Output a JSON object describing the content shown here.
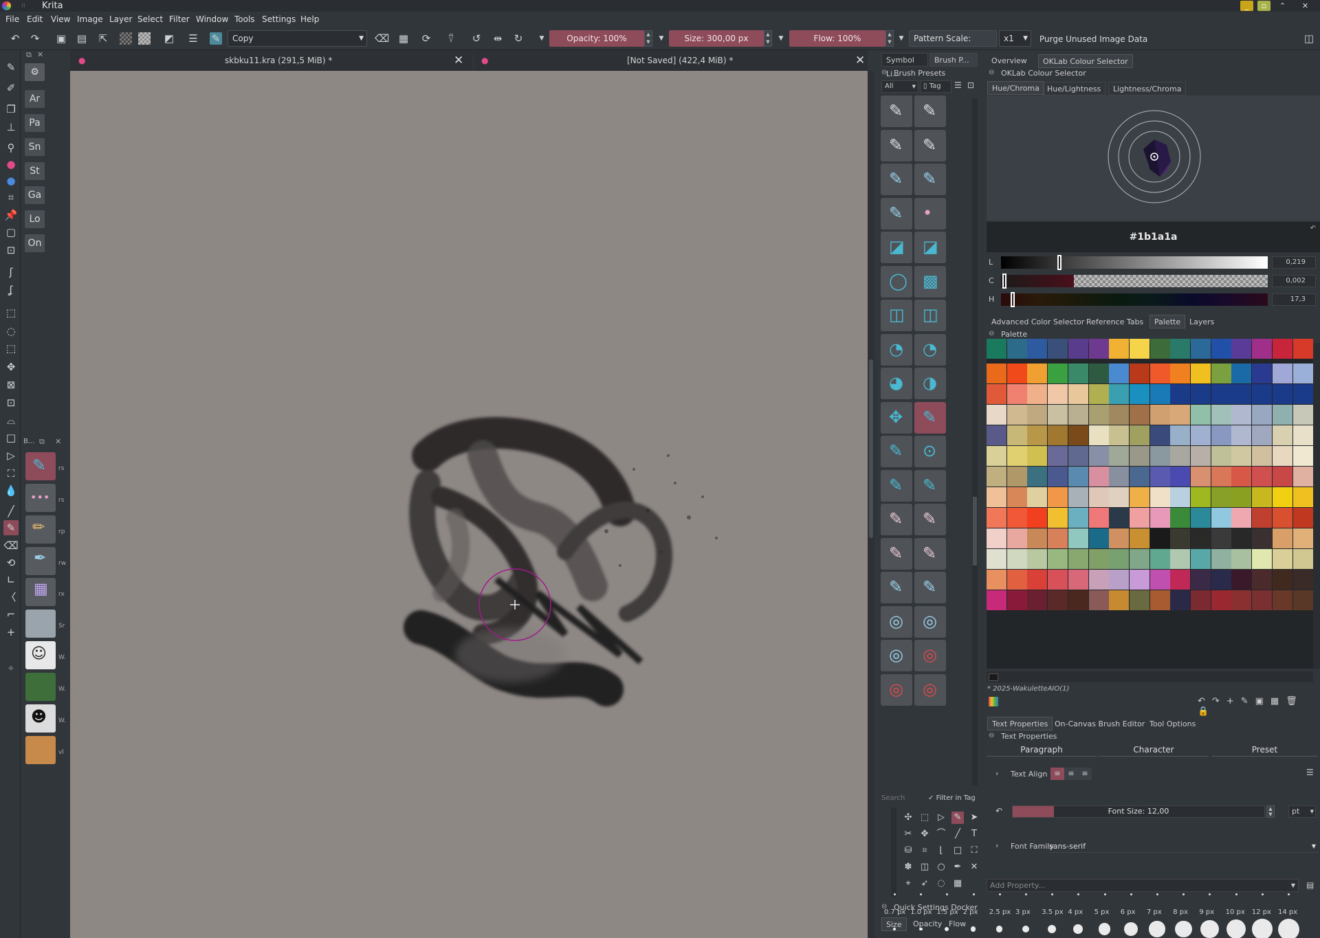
{
  "app": {
    "title": "Krita"
  },
  "menu": [
    "File",
    "Edit",
    "View",
    "Image",
    "Layer",
    "Select",
    "Filter",
    "Window",
    "Tools",
    "Settings",
    "Help"
  ],
  "toolbar": {
    "blend_mode": "Copy",
    "opacity": "Opacity: 100%",
    "size": "Size: 300,00 px",
    "flow": "Flow: 100%",
    "pattern_scale": "Pattern Scale: 1,00x",
    "mirror": "x1",
    "purge": "Purge Unused Image Data"
  },
  "shortcuts": [
    "Ar",
    "Pa",
    "Sn",
    "St",
    "Ga",
    "Lo",
    "On"
  ],
  "brush_mini_labels": [
    "rs",
    "rs",
    "rp",
    "rw",
    "rx",
    "Sr",
    "W.",
    "W.",
    "W.",
    "vl"
  ],
  "brush_mini_header": "B...",
  "documents": [
    {
      "title": "skbku11.kra (291,5 MiB) *"
    },
    {
      "title": "[Not Saved]  (422,4 MiB) *"
    }
  ],
  "brush_presets": {
    "tabs": [
      "Symbol Li...",
      "Brush P..."
    ],
    "header": "Brush Presets",
    "filter": "All",
    "tag": "Tag",
    "search_placeholder": "Search",
    "filter_in_tag": "Filter in Tag"
  },
  "color_selector": {
    "tabs": [
      "Overview",
      "OKLab Colour Selector"
    ],
    "header": "OKLab Colour Selector",
    "mode_tabs": [
      "Hue/Chroma",
      "Hue/Lightness",
      "Lightness/Chroma"
    ],
    "hex": "#1b1a1a",
    "channels": [
      {
        "name": "L",
        "value": "0,219"
      },
      {
        "name": "C",
        "value": "0,002"
      },
      {
        "name": "H",
        "value": "17,3"
      }
    ]
  },
  "dock_tabs": [
    "Advanced Color Selector",
    "Reference Tabs",
    "Palette",
    "Layers"
  ],
  "palette": {
    "header": "Palette",
    "name": "* 2025-WakuletteAIO(1)",
    "colors": [
      [
        "#1a7a5e",
        "#2d6b8a",
        "#2e5aa0",
        "#3a4f7a",
        "#5a3c8c",
        "#6e3a90",
        "#f1b233",
        "#f5d44a",
        "#3d6b3a",
        "#2a7a6a",
        "#2b6a98",
        "#2050a8",
        "#5a3c98",
        "#a02f8a",
        "#c8243a",
        "#d83a2a"
      ],
      [
        "#e86a1a",
        "#f04a1a",
        "#f0a030",
        "#3aa040",
        "#3a8a6a",
        "#2d5a40",
        "#4a8ad0",
        "#b83a1a",
        "#f05a2a",
        "#f08020",
        "#f0c020",
        "#7aa040",
        "#1a6aa8",
        "#2a3a90",
        "#a0a8d8",
        "#9ab0d8"
      ],
      [
        "#e05a3a",
        "#f08070",
        "#f0b08a",
        "#f0c8a8",
        "#e8c89a",
        "#b0b050",
        "#3aa0b0",
        "#1a90c0",
        "#1a7ab8",
        "#1a3a8a",
        "#1a3a8a",
        "#1a3a8a",
        "#1a3a8a",
        "#1a3a8a",
        "#1a3a8a",
        "#1a3a8a"
      ],
      [
        "#e8d8c8",
        "#d0b890",
        "#c0a880",
        "#c8c0a0",
        "#b8b090",
        "#a8a070",
        "#a08860",
        "#a07048",
        "#d0a070",
        "#d8a878",
        "#90c0a8",
        "#a0c0b8",
        "#b0b8d0",
        "#98a8c0",
        "#90b0b0",
        "#c8c8b8"
      ],
      [
        "#5a5a8a",
        "#c8b878",
        "#b89848",
        "#a07830",
        "#7a4a1a",
        "#e8e0c0",
        "#c8c090",
        "#a0a060",
        "#3a4a7a",
        "#98b0c8",
        "#a0b0d0",
        "#8898c0",
        "#b0b8d0",
        "#a0a8c0",
        "#d8d0b0",
        "#e8e0c8"
      ],
      [
        "#d8d098",
        "#e0d070",
        "#d0c050",
        "#6a6a98",
        "#606a90",
        "#8890a8",
        "#a0a898",
        "#9a9888",
        "#8a98a0",
        "#a8a8a0",
        "#b8b0a8",
        "#c0c098",
        "#d0c8a0",
        "#d0c0a0",
        "#e8d8c0",
        "#f0e8d0"
      ],
      [
        "#c0b080",
        "#b09868",
        "#3a7080",
        "#4a5a90",
        "#5a8ab0",
        "#d890a0",
        "#8890a0",
        "#4a6890",
        "#5a5ab0",
        "#4a4ab0",
        "#d89070",
        "#d87858",
        "#d85848",
        "#d05050",
        "#c84848",
        "#e0b0a0"
      ],
      [
        "#f0c098",
        "#d88858",
        "#e0d0a0",
        "#f09848",
        "#a8b0b8",
        "#e0c8b8",
        "#e0d0c0",
        "#f0b048",
        "#f0e0c8",
        "#b8d0e0",
        "#a0b820",
        "#88a028",
        "#8aa020",
        "#c8b820",
        "#f0d010",
        "#f0c020"
      ],
      [
        "#f07858",
        "#f05838",
        "#f04020",
        "#f0c030",
        "#6ab0c0",
        "#f07878",
        "#2a3a48",
        "#f0a0a0",
        "#e898b8",
        "#3a8a3a",
        "#2a8a9a",
        "#90c8e0",
        "#f0a8b0",
        "#c04030",
        "#d85030",
        "#c03820"
      ],
      [
        "#f0d0c8",
        "#e8a8a0",
        "#c88858",
        "#d8805a",
        "#90c8c0",
        "#1a6a8a",
        "#d09060",
        "#c89030",
        "#1a1a1a",
        "#3a3a30",
        "#2a2a28",
        "#3a3a3a",
        "#282828",
        "#3a3030",
        "#d8a068",
        "#e0b078"
      ],
      [
        "#e0e0d0",
        "#d0d8c0",
        "#b8c8a0",
        "#98b880",
        "#88a870",
        "#80a068",
        "#78a070",
        "#80a888",
        "#60a890",
        "#b0c8b0",
        "#58a8a8",
        "#90b0a0",
        "#a8c0a0",
        "#e0e8b0",
        "#d8d098",
        "#d0c890"
      ],
      [
        "#e89060",
        "#e06040",
        "#d84038",
        "#d85058",
        "#d86878",
        "#c8a0b8",
        "#b8a0c8",
        "#c89ad8",
        "#c050b0",
        "#c02858",
        "#3a2a48",
        "#2a2a4a",
        "#3a1a2a",
        "#4a2a2a",
        "#402a20",
        "#3a2a28"
      ],
      [
        "#c82a7a",
        "#8a1a3a",
        "#6a2030",
        "#5a2a28",
        "#4a2820",
        "#8a5a58",
        "#c88a30",
        "#6a6a40",
        "#a85a30",
        "#2a2a48",
        "#7a2a30",
        "#9a2830",
        "#8a3030",
        "#7a3030",
        "#6a3828",
        "#5a3828"
      ]
    ]
  },
  "text_props": {
    "tabs": [
      "Text Properties",
      "On-Canvas Brush Editor",
      "Tool Options"
    ],
    "header": "Text Properties",
    "sub_tabs": [
      "Paragraph",
      "Character",
      "Preset"
    ],
    "text_align": "Text Align",
    "font_size": "Font Size: 12,00",
    "font_unit": "pt",
    "font_family_label": "Font Family",
    "font_family": "sans-serif",
    "add_property": "Add Property..."
  },
  "quick_settings": {
    "header": "Quick Settings Docker",
    "tabs": [
      "Size",
      "Opacity",
      "Flow"
    ],
    "sizes": [
      "0.7 px",
      "1.0 px",
      "1.5 px",
      "2 px",
      "2.5 px",
      "3 px",
      "3.5 px",
      "4 px",
      "5 px",
      "6 px",
      "7 px",
      "8 px",
      "9 px",
      "10 px",
      "12 px",
      "14 px"
    ]
  }
}
